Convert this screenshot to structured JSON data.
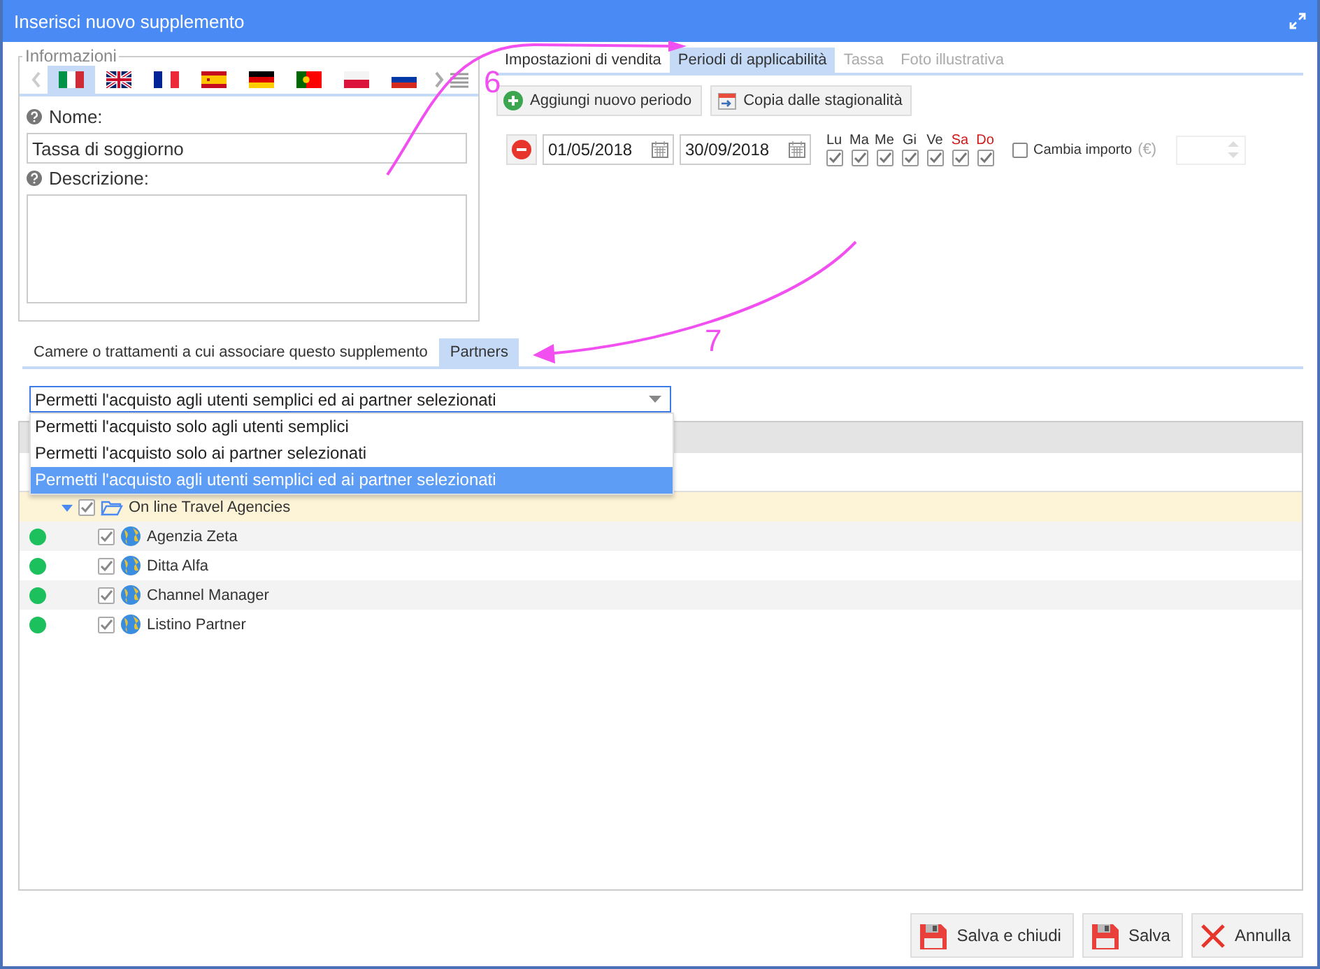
{
  "window": {
    "title": "Inserisci nuovo supplemento"
  },
  "info_panel": {
    "legend": "Informazioni",
    "languages": [
      {
        "kind": "it",
        "selected": true
      },
      {
        "kind": "gb",
        "selected": false
      },
      {
        "kind": "fr",
        "selected": false
      },
      {
        "kind": "es",
        "selected": false
      },
      {
        "kind": "de",
        "selected": false
      },
      {
        "kind": "pt",
        "selected": false
      },
      {
        "kind": "pl",
        "selected": false
      },
      {
        "kind": "ru",
        "selected": false
      }
    ],
    "name_label": "Nome:",
    "name_value": "Tassa di soggiorno",
    "description_label": "Descrizione:"
  },
  "period_tabs": [
    {
      "label": "Impostazioni di vendita",
      "selected": false,
      "disabled": false
    },
    {
      "label": "Periodi di applicabilità",
      "selected": true,
      "disabled": false
    },
    {
      "label": "Tassa",
      "selected": false,
      "disabled": true
    },
    {
      "label": "Foto illustrativa",
      "selected": false,
      "disabled": true
    }
  ],
  "period_actions": [
    {
      "label": "Aggiungi nuovo periodo",
      "kind": "add"
    },
    {
      "label": "Copia dalle stagionalità",
      "kind": "calendar"
    }
  ],
  "periods": [
    {
      "from": "01/05/2018",
      "to": "30/09/2018",
      "days": [
        {
          "label": "Lu",
          "checked": true,
          "weekend": false
        },
        {
          "label": "Ma",
          "checked": true,
          "weekend": false
        },
        {
          "label": "Me",
          "checked": true,
          "weekend": false
        },
        {
          "label": "Gi",
          "checked": true,
          "weekend": false
        },
        {
          "label": "Ve",
          "checked": true,
          "weekend": false
        },
        {
          "label": "Sa",
          "checked": true,
          "weekend": true
        },
        {
          "label": "Do",
          "checked": true,
          "weekend": true
        }
      ],
      "change_amount": {
        "label": "Cambia importo",
        "checked": false,
        "currency": "(€)"
      }
    }
  ],
  "lower_tabs": [
    {
      "label": "Camere o trattamenti a cui associare questo supplemento",
      "selected": false
    },
    {
      "label": "Partners",
      "selected": true
    }
  ],
  "access_dropdown": {
    "value": "Permetti l'acquisto agli utenti semplici ed ai partner selezionati",
    "expanded": true,
    "options": [
      {
        "label": "Permetti l'acquisto solo agli utenti semplici",
        "selected": false
      },
      {
        "label": "Permetti l'acquisto solo ai partner selezionati",
        "selected": false
      },
      {
        "label": "Permetti l'acquisto agli utenti semplici ed ai partner selezionati",
        "selected": true
      }
    ]
  },
  "partners": [
    {
      "label": "On line Travel Agencies",
      "checked": true,
      "expanded": true,
      "children": [
        {
          "label": "Agenzia Zeta",
          "checked": true,
          "color": "#1cc15e"
        },
        {
          "label": "Ditta Alfa",
          "checked": true,
          "color": "#1cc15e"
        },
        {
          "label": "Channel Manager",
          "checked": true,
          "color": "#1cc15e"
        },
        {
          "label": "Listino Partner",
          "checked": true,
          "color": "#1cc15e"
        }
      ]
    }
  ],
  "buttons": [
    {
      "label": "Salva e chiudi",
      "kind": "save"
    },
    {
      "label": "Salva",
      "kind": "save"
    },
    {
      "label": "Annulla",
      "kind": "cancel"
    }
  ],
  "annotations": [
    {
      "label": "6"
    },
    {
      "label": "7"
    }
  ]
}
